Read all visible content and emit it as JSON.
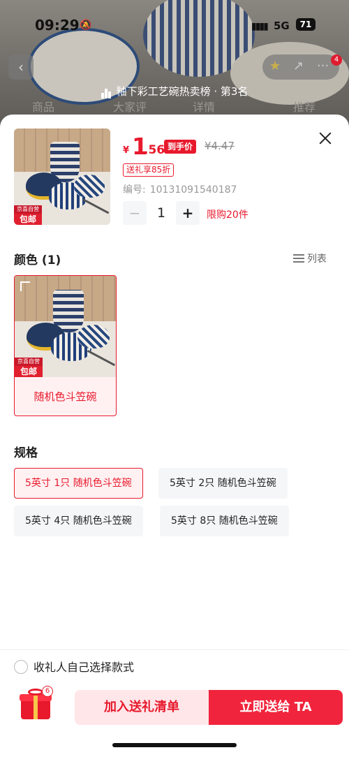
{
  "status_bar": {
    "time": "09:29",
    "network": "5G",
    "battery": "71"
  },
  "background_page": {
    "rank_text": "釉下彩工艺碗热卖榜 · 第3名",
    "tabs": [
      "商品",
      "大家评",
      "详情",
      "推荐"
    ],
    "cart_badge": "4"
  },
  "product": {
    "currency": "¥",
    "price_int": "1",
    "price_dec": ".56",
    "price_tag": "到手价",
    "original_price": "¥4.47",
    "discount_tag": "送礼享85折",
    "sku_label": "编号:",
    "sku_value": "10131091540187",
    "quantity": "1",
    "limit_text": "限购20件",
    "image_badge_top": "京喜自营",
    "image_badge_bottom": "包邮"
  },
  "color_section": {
    "title": "颜色 (1)",
    "list_toggle": "列表",
    "options": [
      {
        "label": "随机色斗笠碗",
        "selected": true,
        "badge_top": "京喜自营",
        "badge_bottom": "包邮"
      }
    ]
  },
  "spec_section": {
    "title": "规格",
    "options": [
      {
        "label": "5英寸 1只 随机色斗笠碗",
        "selected": true
      },
      {
        "label": "5英寸 2只 随机色斗笠碗",
        "selected": false
      },
      {
        "label": "5英寸 4只 随机色斗笠碗",
        "selected": false
      },
      {
        "label": "5英寸 8只 随机色斗笠碗",
        "selected": false
      }
    ]
  },
  "footer": {
    "gift_choice_label": "收礼人自己选择款式",
    "gift_count": "6",
    "add_button": "加入送礼清单",
    "send_button": "立即送给 TA"
  },
  "colors": {
    "accent": "#e8192c",
    "accent_light": "#fff1f2",
    "button_bg": "#f5f6f8"
  }
}
